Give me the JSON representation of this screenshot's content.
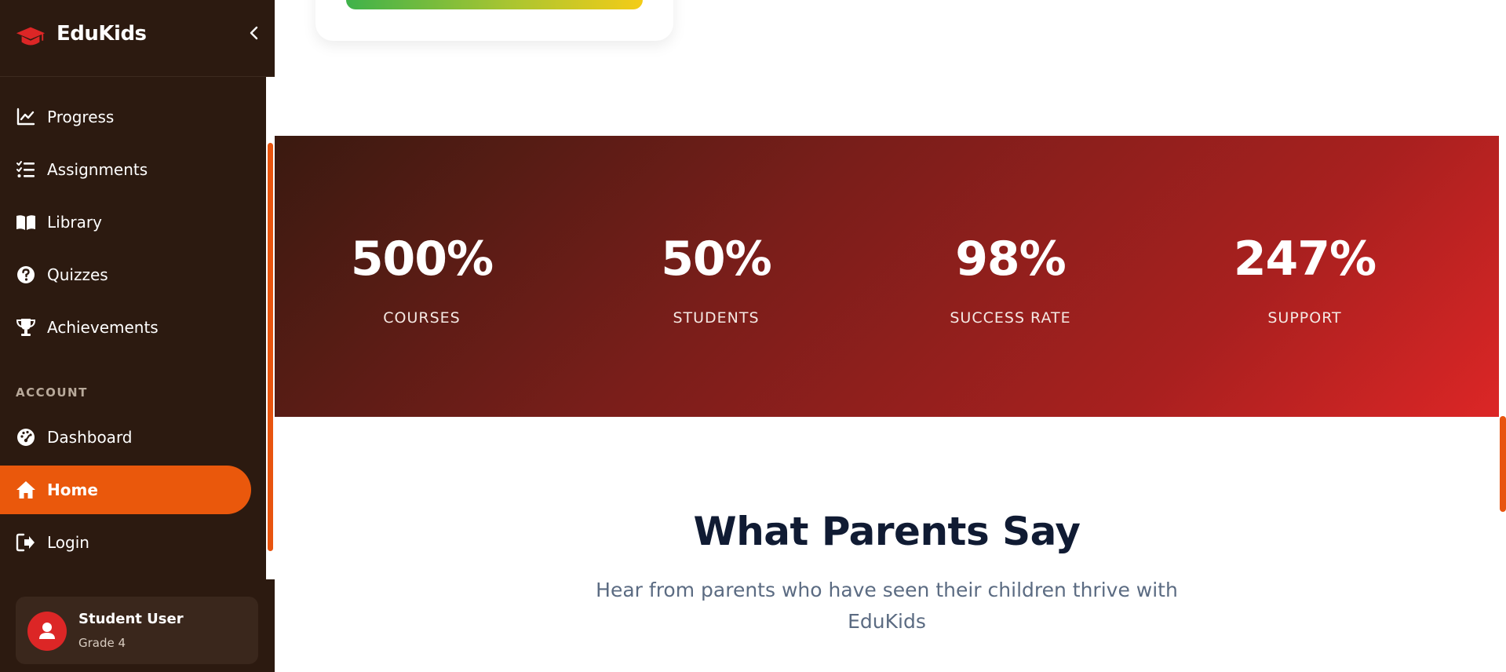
{
  "brand": {
    "name": "EduKids"
  },
  "sidebar": {
    "items": [
      {
        "label": "Progress",
        "icon": "chart-line-icon"
      },
      {
        "label": "Assignments",
        "icon": "list-check-icon"
      },
      {
        "label": "Library",
        "icon": "book-open-icon"
      },
      {
        "label": "Quizzes",
        "icon": "question-circle-icon"
      },
      {
        "label": "Achievements",
        "icon": "trophy-icon"
      }
    ],
    "account_label": "ACCOUNT",
    "account_items": [
      {
        "label": "Dashboard",
        "icon": "gauge-icon"
      },
      {
        "label": "Home",
        "icon": "home-icon",
        "active": true
      },
      {
        "label": "Login",
        "icon": "sign-in-icon"
      }
    ]
  },
  "user": {
    "name": "Student User",
    "grade": "Grade 4"
  },
  "stats": [
    {
      "value": "500%",
      "label": "COURSES"
    },
    {
      "value": "50%",
      "label": "STUDENTS"
    },
    {
      "value": "98%",
      "label": "SUCCESS RATE"
    },
    {
      "value": "247%",
      "label": "SUPPORT"
    }
  ],
  "testimonials": {
    "title": "What Parents Say",
    "subtitle": "Hear from parents who have seen their children thrive with EduKids"
  },
  "colors": {
    "sidebar_bg": "#2c1a10",
    "accent": "#ea580c",
    "brand_red": "#dc2626",
    "stats_gradient_start": "#3a1a10",
    "stats_gradient_end": "#dc2626",
    "title_color": "#101b33"
  }
}
